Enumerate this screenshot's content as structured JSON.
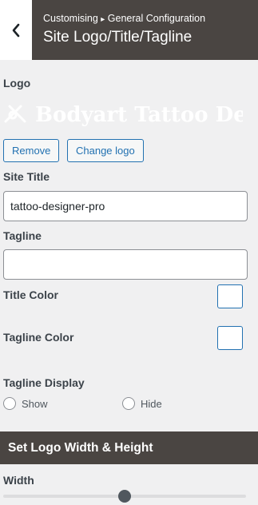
{
  "header": {
    "breadcrumb_root": "Customising",
    "breadcrumb_separator": "▸",
    "breadcrumb_section": "General Configuration",
    "title": "Site Logo/Title/Tagline",
    "back_icon": "chevron-left-icon"
  },
  "logo": {
    "label": "Logo",
    "image_text": "Bodyart Tattoo Designer",
    "remove_label": "Remove",
    "change_label": "Change logo"
  },
  "site_title": {
    "label": "Site Title",
    "value": "tattoo-designer-pro"
  },
  "tagline": {
    "label": "Tagline",
    "value": ""
  },
  "title_color": {
    "label": "Title Color",
    "value": "#ffffff"
  },
  "tagline_color": {
    "label": "Tagline Color",
    "value": "#ffffff"
  },
  "tagline_display": {
    "label": "Tagline Display",
    "options": [
      {
        "label": "Show",
        "selected": false
      },
      {
        "label": "Hide",
        "selected": false
      }
    ]
  },
  "logo_size": {
    "section_title": "Set Logo Width & Height",
    "width_label": "Width",
    "width_fraction": 0.5
  },
  "colors": {
    "header_bg": "#4a4542",
    "accent": "#2271b1"
  }
}
